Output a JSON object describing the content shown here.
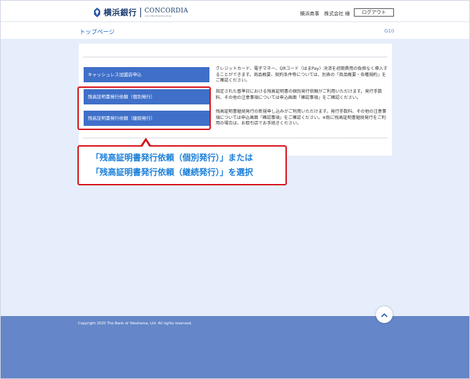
{
  "header": {
    "logo_jp": "横浜銀行",
    "logo_en": "CONCORDIA",
    "logo_en_sub": "concordia financial group",
    "user_name": "横浜商事　株式会社 様",
    "logout_label": "ログアウト"
  },
  "titlebar": {
    "title": "トップページ",
    "page_id": "G10"
  },
  "menu": {
    "items": [
      {
        "label": "キャッシュレス加盟店申込",
        "desc": "クレジットカード、電子マネー、QRコード（はまPay）決済を初期費用の負担なく導入することができます。商品概要、契約条件等については、別表の「商品概要・各種規約」をご確認ください。"
      },
      {
        "label": "残高証明書発行依頼（個別発行）",
        "desc": "指定された基準日における残高証明書の個別発行依頼がご利用いただけます。発行手数料、その他の注意事項については申込画面「確認事項」をご確認ください。"
      },
      {
        "label": "残高証明書発行依頼（継続発行）",
        "desc": "残高証明書継続発行の新規申し込みがご利用いただけます。発行手数料、その他の注意事項については申込画面「確認事項」をご確認ください。※既に残高証明書継続発行をご利用の場合は、お取引店でお手続きください。"
      }
    ]
  },
  "callout": {
    "line1": "「残高証明書発行依頼（個別発行）」または",
    "line2": "「残高証明書発行依頼（継続発行）」を選択"
  },
  "footer": {
    "copyright": "Copyright 2020 The Bank of Yokohama, Ltd. All rights reserved."
  },
  "icons": {
    "back_to_top": "chevron-up-icon",
    "logo_mark": "bank-logo-icon"
  },
  "colors": {
    "accent": "#3f6fc8",
    "highlight": "#d8121c",
    "callout_text": "#1a7fd8",
    "footer": "#6586c8",
    "page_bg": "#e6eefb"
  }
}
